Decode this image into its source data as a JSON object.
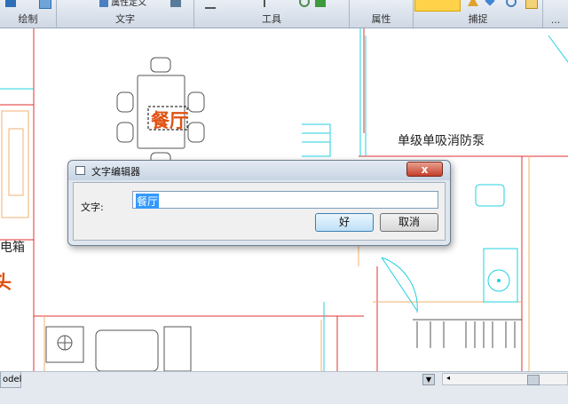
{
  "ribbon": {
    "panels": [
      {
        "label": "绘制"
      },
      {
        "label": "文字",
        "button": "属性定义"
      },
      {
        "label": "工具"
      },
      {
        "label": "属性"
      },
      {
        "label": "捕捉"
      },
      {
        "label": "..."
      }
    ]
  },
  "drawing": {
    "room_dining": "餐厅",
    "pump_label": "单级单吸消防泵",
    "left_label": "电箱",
    "left_red": "头"
  },
  "dialog": {
    "title": "文字编辑器",
    "close_symbol": "x",
    "field_label": "文字:",
    "field_value": "餐厅",
    "ok_label": "好",
    "cancel_label": "取消"
  },
  "status": {
    "tab_label": "odel"
  }
}
